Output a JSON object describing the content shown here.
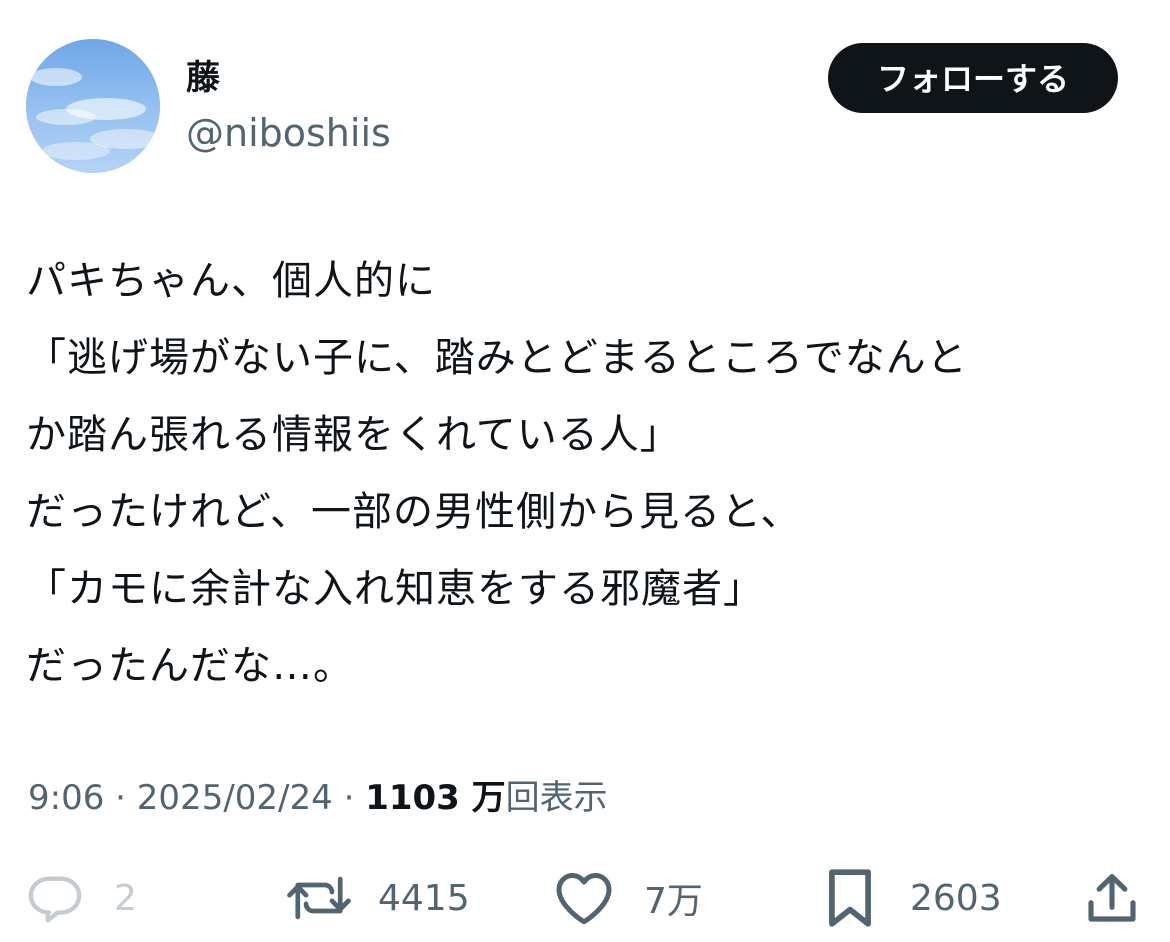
{
  "user": {
    "display_name": "藤",
    "handle": "@niboshiis"
  },
  "follow_button": {
    "label": "フォローする"
  },
  "tweet": {
    "lines": [
      "パキちゃん、個人的に",
      "「逃げ場がない子に、踏みとどまるところでなんと",
      "か踏ん張れる情報をくれている人」",
      "だったけれど、一部の男性側から見ると、",
      "「カモに余計な入れ知恵をする邪魔者」",
      "だったんだな…。"
    ]
  },
  "meta": {
    "time": "9:06",
    "separator": " · ",
    "date": "2025/02/24",
    "views_count": "1103 万",
    "views_label": "回表示"
  },
  "actions": {
    "reply": {
      "icon": "reply-icon",
      "count": "2"
    },
    "retweet": {
      "icon": "retweet-icon",
      "count": "4415"
    },
    "like": {
      "icon": "heart-icon",
      "count": "7万"
    },
    "bookmark": {
      "icon": "bookmark-icon",
      "count": "2603"
    },
    "share": {
      "icon": "share-icon"
    }
  },
  "colors": {
    "text_primary": "#0f1419",
    "text_secondary": "#536471",
    "button_bg": "#0f1419",
    "button_text": "#ffffff",
    "reply_disabled": "#c4cbd1",
    "avatar_sky": "#8dbcef"
  }
}
